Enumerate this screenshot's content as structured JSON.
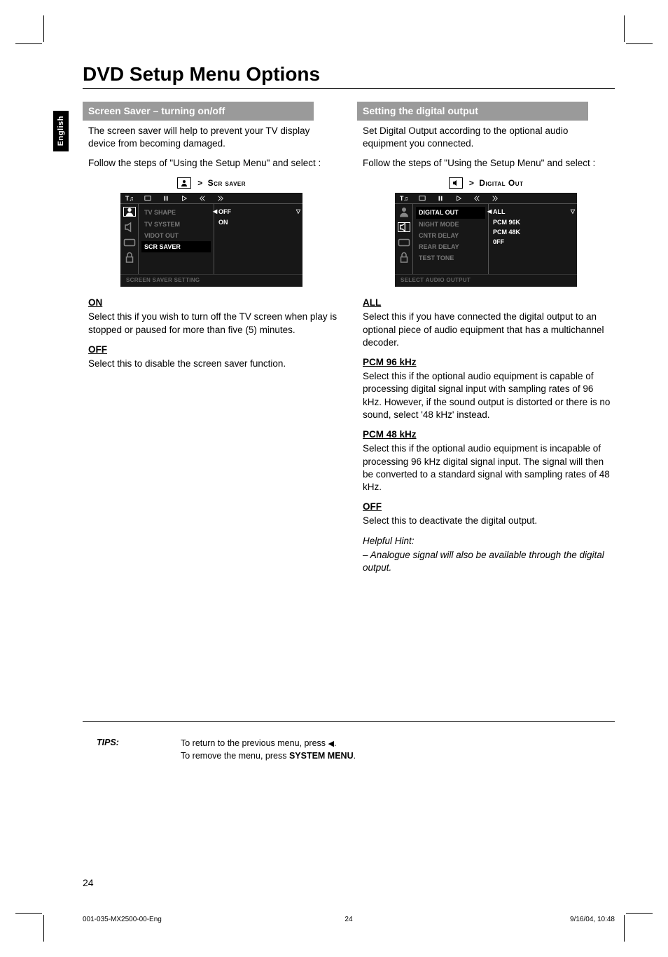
{
  "lang_tab": "English",
  "title": "DVD Setup Menu Options",
  "left": {
    "header": "Screen Saver – turning on/off",
    "p1": "The screen saver will help to prevent your TV display device from becoming damaged.",
    "p2": "Follow the steps of \"Using the Setup Menu\" and select :",
    "menu_label": "Scr saver",
    "osd": {
      "items": [
        "TV SHAPE",
        "TV SYSTEM",
        "VIDOT OUT",
        "SCR SAVER"
      ],
      "sub": [
        "OFF",
        "ON"
      ],
      "footer": "SCREEN SAVER SETTING"
    },
    "opt1_h": "ON",
    "opt1_p": "Select this if you wish to turn off the TV screen when play is stopped or paused for more than five (5) minutes.",
    "opt2_h": "OFF",
    "opt2_p": "Select this to disable the screen saver function."
  },
  "right": {
    "header": "Setting the digital output",
    "p1": "Set Digital Output according to the optional audio equipment you connected.",
    "p2": "Follow the steps of \"Using the Setup Menu\" and select :",
    "menu_label": "Digital Out",
    "osd": {
      "items": [
        "DIGITAL OUT",
        "NIGHT MODE",
        "CNTR DELAY",
        "REAR DELAY",
        "TEST TONE"
      ],
      "sub": [
        "ALL",
        "PCM 96K",
        "PCM 48K",
        "0FF"
      ],
      "footer": "SELECT AUDIO OUTPUT"
    },
    "opt1_h": "ALL",
    "opt1_p": "Select this if you have connected the digital output to an optional piece of audio equipment that has a multichannel decoder.",
    "opt2_h": "PCM 96 kHz",
    "opt2_p": "Select this if the optional audio equipment is capable of processing digital signal input with sampling rates of 96 kHz.  However, if the sound output is distorted or there is no sound, select '48 kHz' instead.",
    "opt3_h": "PCM 48 kHz",
    "opt3_p": "Select this if the optional audio equipment is incapable of processing 96 kHz digital signal input.  The signal will then be converted to a standard signal with sampling rates of 48 kHz.",
    "opt4_h": "OFF",
    "opt4_p": "Select this to deactivate the digital output.",
    "hint_h": "Helpful Hint:",
    "hint_p": "–  Analogue signal will also be available through the digital output."
  },
  "tips": {
    "label": "TIPS:",
    "line1a": "To return to the previous menu, press ",
    "line1b": ".",
    "line2a": "To remove the menu, press ",
    "line2b": "SYSTEM MENU",
    "line2c": "."
  },
  "page_num": "24",
  "footer": {
    "left": "001-035-MX2500-00-Eng",
    "mid": "24",
    "right": "9/16/04, 10:48"
  }
}
